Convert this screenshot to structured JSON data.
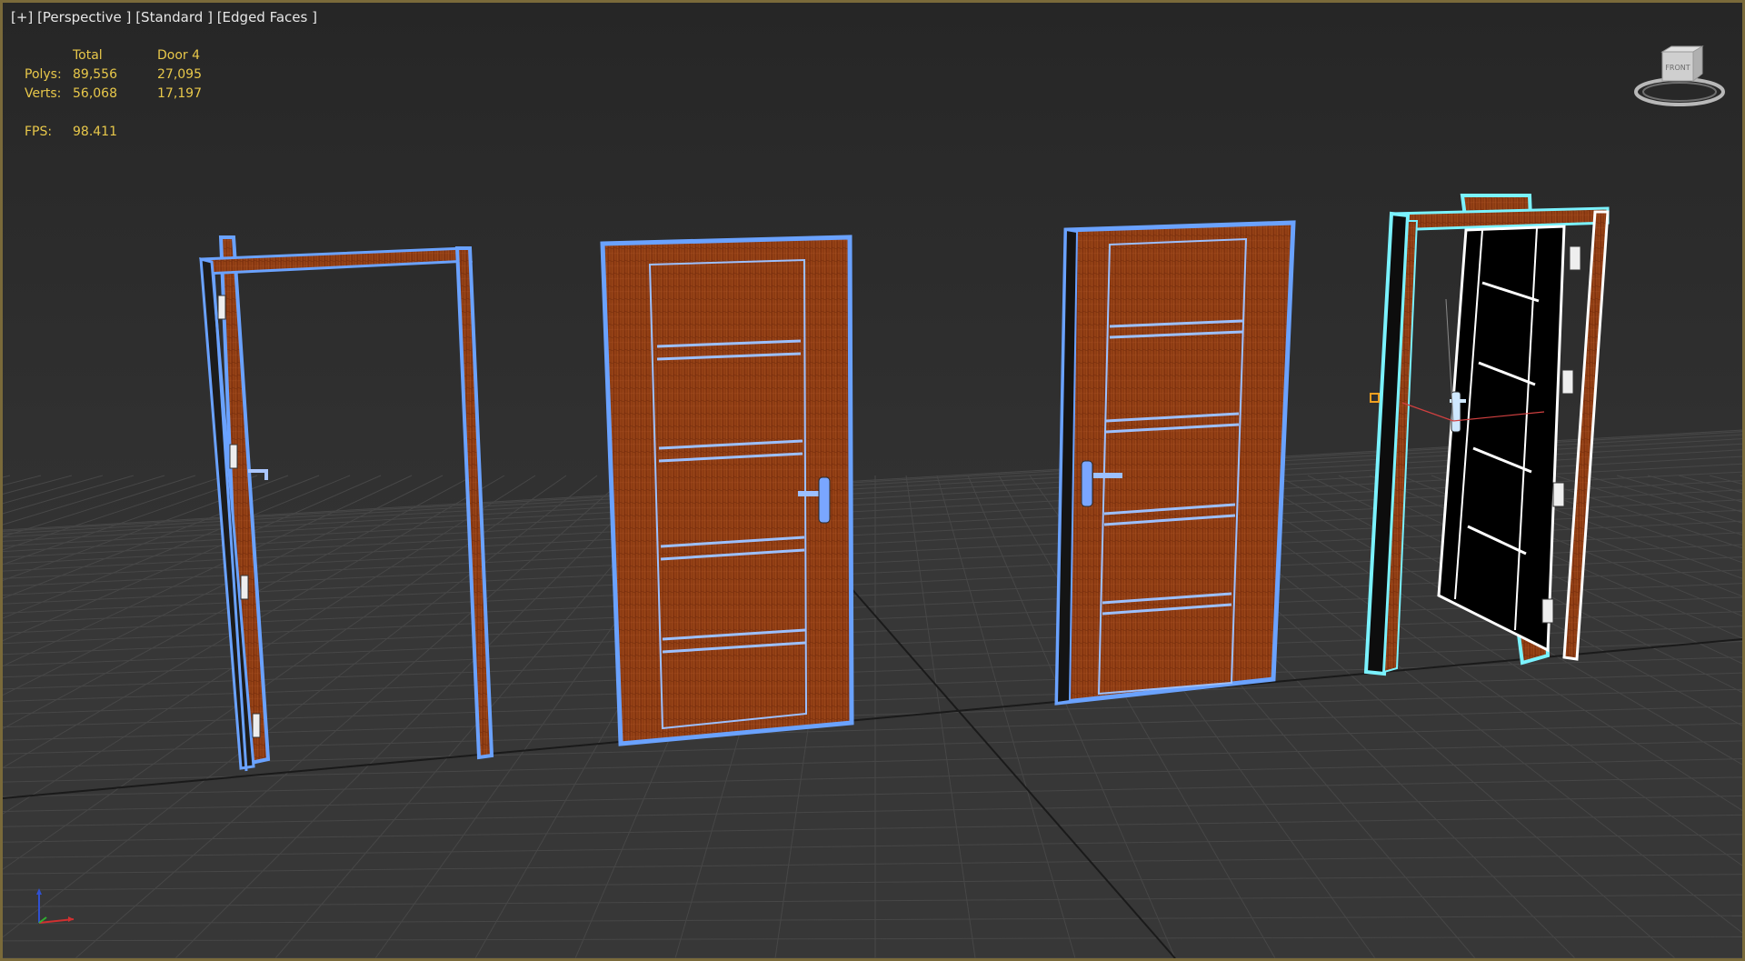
{
  "viewport": {
    "label": {
      "plus": "[+]",
      "view": "[Perspective ]",
      "shading": "[Standard ]",
      "mode": "[Edged Faces ]"
    },
    "stats": {
      "header_total": "Total",
      "header_selected": "Door 4",
      "polys_label": "Polys:",
      "polys_total": "89,556",
      "polys_selected": "27,095",
      "verts_label": "Verts:",
      "verts_total": "56,068",
      "verts_selected": "17,197",
      "fps_label": "FPS:",
      "fps_value": "98.411"
    },
    "viewcube_face": "FRONT"
  },
  "colors": {
    "border": "#7a6a3a",
    "stats_text": "#e8c84a",
    "selection_outline": "#6aa2ff",
    "selected_object": "#7af2ff",
    "wood": "#8a3a12",
    "grid": "#4a4a4a"
  },
  "icons": [
    "viewcube-icon",
    "axis-triad-icon"
  ]
}
